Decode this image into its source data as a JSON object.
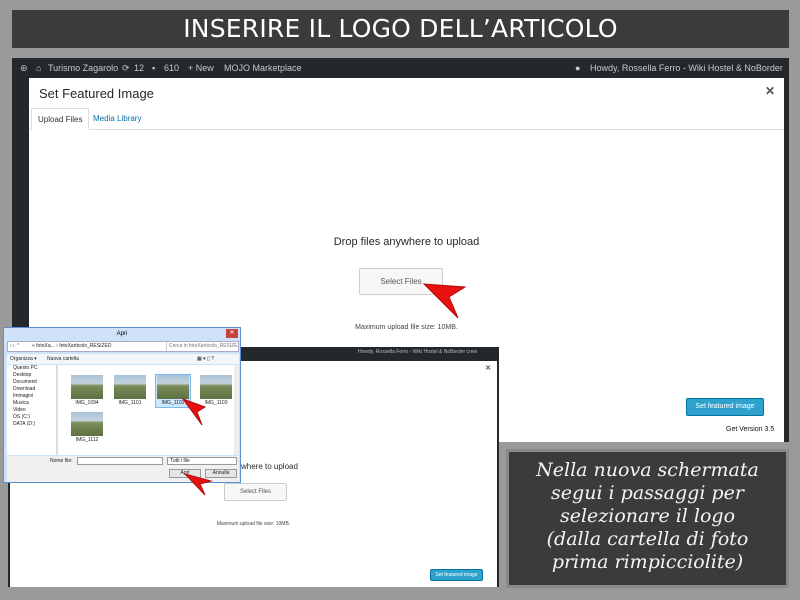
{
  "banner": {
    "title": "INSERIRE IL LOGO DELL’ARTICOLO"
  },
  "admin_bar": {
    "site": "Turismo Zagarolo",
    "updates": "12",
    "comments": "610",
    "new": "+ New",
    "marketplace": "MOJO Marketplace",
    "howdy": "Howdy, Rossella Ferro - Wiki Hostel & NoBorder crew"
  },
  "modal": {
    "title": "Set Featured Image",
    "tabs": [
      "Upload Files",
      "Media Library"
    ],
    "drop_text": "Drop files anywhere to upload",
    "select_button": "Select Files",
    "max_size": "Maximum upload file size: 10MB.",
    "feature_button": "Set featured image",
    "version": "Get Version 3.5",
    "drop_text_partial": "ywhere to upload"
  },
  "dialog": {
    "title": "Apri",
    "address": "« fotoXa... › fotoXarticolo_RESIZED",
    "search_placeholder": "Cerca in fotoXarticolo_RESIZED",
    "organize": "Organizza ▾",
    "new_folder": "Nuova cartella",
    "nav_items": [
      "Questo PC",
      "Desktop",
      "Documenti",
      "Download",
      "Immagini",
      "Musica",
      "Video",
      "OS (C:)",
      "DATA (D:)"
    ],
    "files": [
      "IMG_1094",
      "IMG_1101",
      "IMG_1102",
      "IMG_1103",
      "IMG_1112"
    ],
    "selected_file": "IMG_1102",
    "filename_label": "Nome file:",
    "filter": "Tutti i file",
    "open_button": "Apri",
    "cancel_button": "Annulla"
  },
  "note": {
    "lines": [
      "Nella nuova schermata",
      "segui i passaggi per",
      "selezionare il logo",
      "(dalla cartella di foto",
      "prima rimpicciolite)"
    ]
  },
  "colors": {
    "accent": "#2ea2cc",
    "arrow": "#e8110f",
    "banner": "#3b3b3b"
  }
}
